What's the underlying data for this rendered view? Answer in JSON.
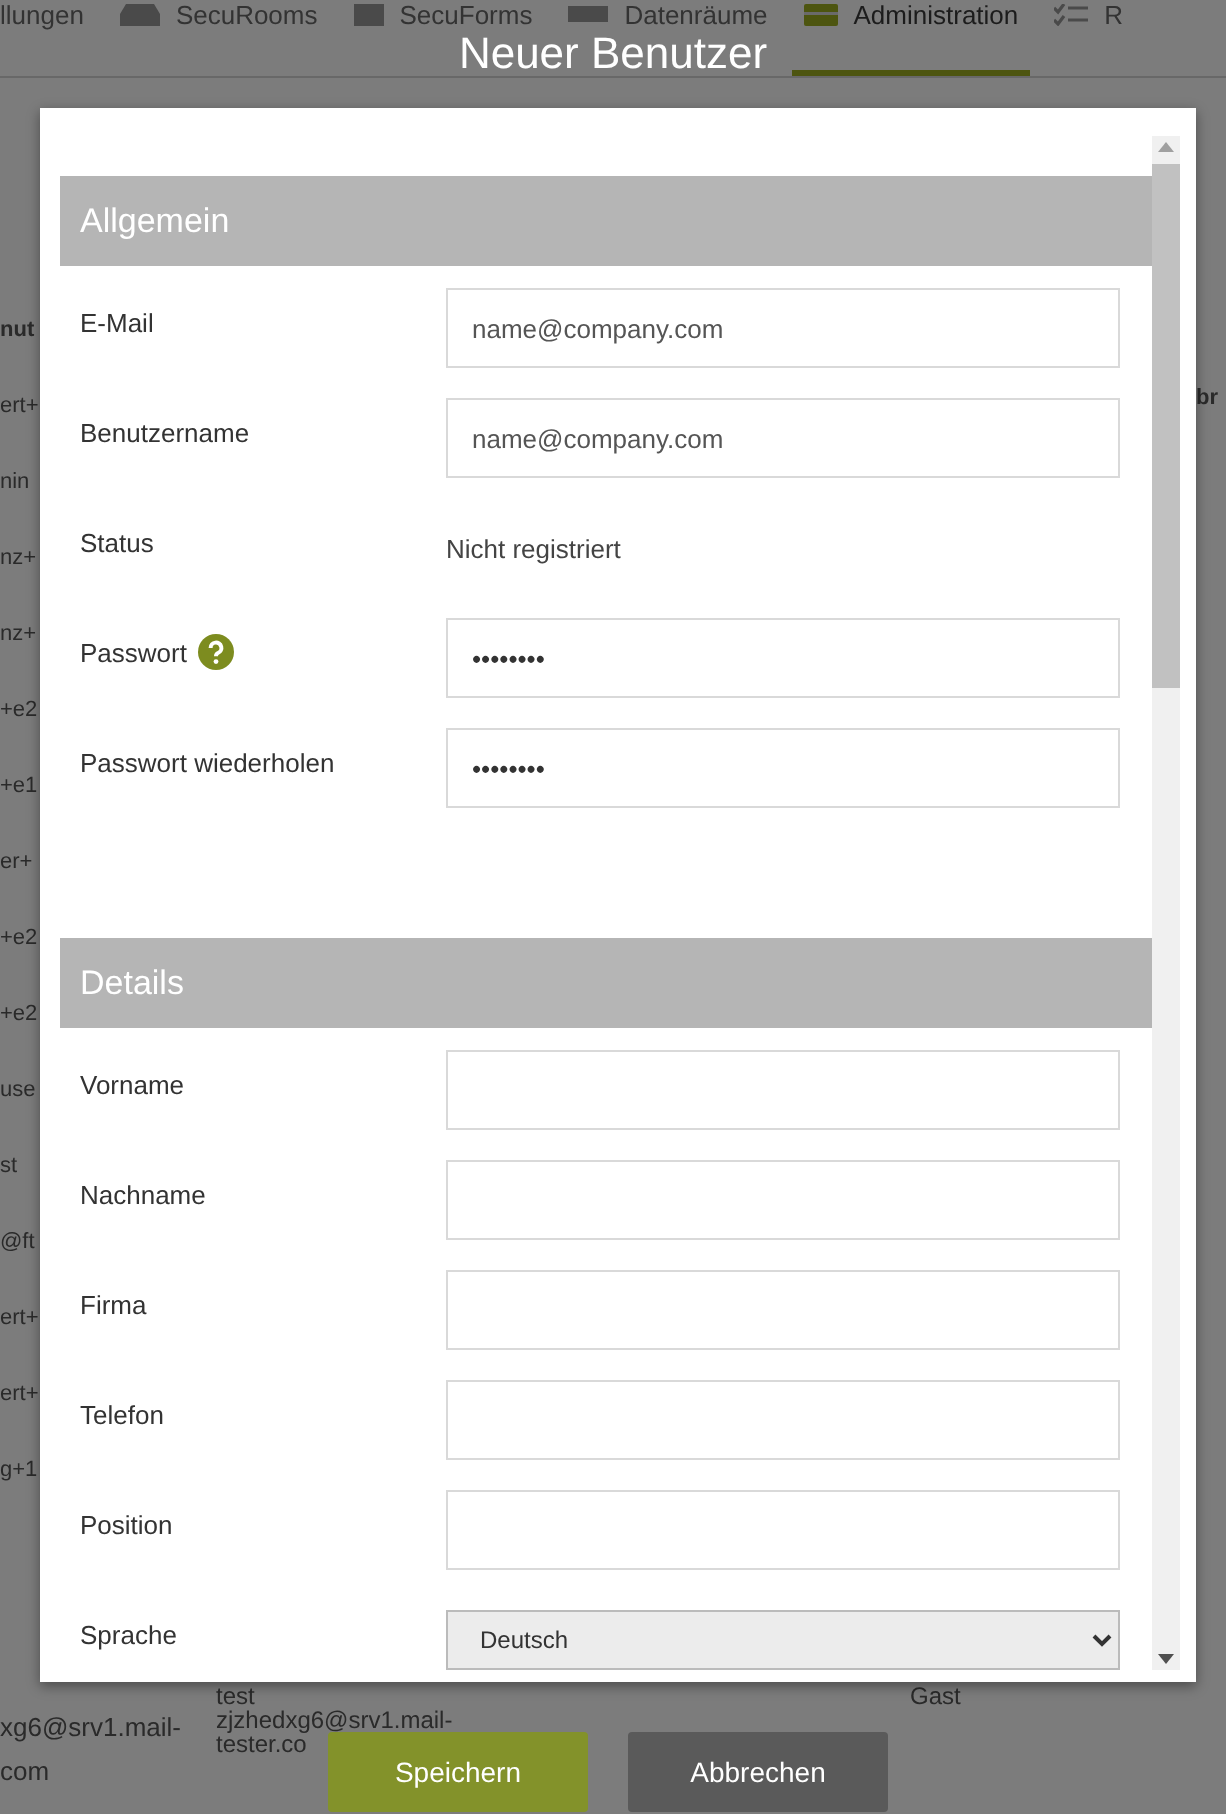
{
  "background": {
    "nav": [
      {
        "label": "llungen",
        "selected": false
      },
      {
        "label": "SecuRooms",
        "selected": false
      },
      {
        "label": "SecuForms",
        "selected": false
      },
      {
        "label": "Datenräume",
        "selected": false
      },
      {
        "label": "Administration",
        "selected": true
      },
      {
        "label": "R",
        "selected": false
      }
    ],
    "header_fragment_left": "nut",
    "header_fragment_right": "br",
    "row_fragments": [
      "ert+",
      "nin",
      "nz+",
      "nz+",
      "+e2",
      "+e1",
      "er+",
      "+e2",
      "+e2",
      "use",
      "st",
      "@ft",
      "ert+",
      "ert+",
      "g+1"
    ],
    "bottom_row": {
      "column_1": [
        "xg6@srv1.mail-",
        "com"
      ],
      "column_2": [
        "test",
        "zjzhedxg6@srv1.mail-",
        "tester.co"
      ],
      "column_3": "Gast"
    }
  },
  "dialog": {
    "title": "Neuer Benutzer",
    "sections": [
      {
        "title": "Allgemein",
        "fields": [
          {
            "kind": "input",
            "label": "E-Mail",
            "placeholder": "name@company.com"
          },
          {
            "kind": "input",
            "label": "Benutzername",
            "placeholder": "name@company.com"
          },
          {
            "kind": "text",
            "label": "Status",
            "value": "Nicht registriert"
          },
          {
            "kind": "input",
            "label": "Passwort",
            "value": "••••••••",
            "help": true
          },
          {
            "kind": "input",
            "label": "Passwort wiederholen",
            "value": "••••••••"
          }
        ]
      },
      {
        "title": "Details",
        "fields": [
          {
            "kind": "input",
            "label": "Vorname"
          },
          {
            "kind": "input",
            "label": "Nachname"
          },
          {
            "kind": "input",
            "label": "Firma"
          },
          {
            "kind": "input",
            "label": "Telefon"
          },
          {
            "kind": "input",
            "label": "Position"
          },
          {
            "kind": "select",
            "label": "Sprache",
            "value": "Deutsch"
          }
        ]
      }
    ],
    "buttons": [
      {
        "label": "Speichern",
        "kind": "primary"
      },
      {
        "label": "Abbrechen",
        "kind": "secondary"
      }
    ]
  }
}
